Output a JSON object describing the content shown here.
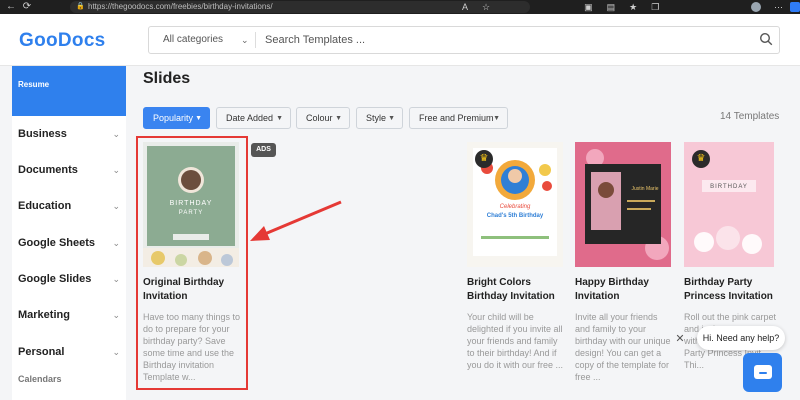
{
  "browser": {
    "url": "https://thegoodocs.com/freebies/birthday-invitations/",
    "back_icon": "arrow-left-icon",
    "refresh_icon": "refresh-icon"
  },
  "header": {
    "logo": "GooDocs",
    "category_label": "All categories",
    "search_placeholder": "Search Templates ...",
    "brand_color": "#2f80ed"
  },
  "sidebar": {
    "resume_label": "Resume",
    "items": [
      {
        "label": "Business"
      },
      {
        "label": "Documents"
      },
      {
        "label": "Education"
      },
      {
        "label": "Google Sheets"
      },
      {
        "label": "Google Slides"
      },
      {
        "label": "Marketing"
      },
      {
        "label": "Personal"
      }
    ],
    "small_label": "Calendars"
  },
  "main": {
    "title": "Slides",
    "filters": [
      {
        "label": "Popularity",
        "active": true
      },
      {
        "label": "Date Added"
      },
      {
        "label": "Colour"
      },
      {
        "label": "Style"
      },
      {
        "label": "Free and Premium"
      }
    ],
    "template_count": "14 Templates",
    "ads_label": "ADS",
    "thumb_texts": {
      "card1_title": "BIRTHDAY",
      "card1_sub": "PARTY",
      "card2_top": "Celebrating",
      "card2_name": "Chad's 5th Birthday",
      "card3_name": "Justin Marie",
      "card4_title": "BIRTHDAY"
    },
    "cards": [
      {
        "name_line1": "Original Birthday",
        "name_line2": "Invitation",
        "desc": [
          "Have too many things to",
          "do to prepare for your",
          "birthday party? Save",
          "some time and use the",
          "Birthday invitation",
          "Template w..."
        ]
      },
      {
        "name_line1": "Bright Colors",
        "name_line2": "Birthday Invitation",
        "desc": [
          "Your child will be",
          "delighted if you invite all",
          "your friends and family",
          "to their birthday! And if",
          "you do it with our free ..."
        ]
      },
      {
        "name_line1": "Happy Birthday",
        "name_line2": "Invitation",
        "desc": [
          "Invite all your friends",
          "and family to your",
          "birthday with our unique",
          "design! You can get a",
          "copy of the template for",
          "free ..."
        ]
      },
      {
        "name_line1": "Birthday Party",
        "name_line2": "Princess Invitation",
        "desc": [
          "Roll out the pink carpet",
          "and invite a",
          "with our Pink Birthday",
          "Party Princess Invit...",
          "Thi..."
        ]
      }
    ]
  },
  "chat": {
    "greeting": "Hi. Need any help?",
    "close": "✕"
  }
}
